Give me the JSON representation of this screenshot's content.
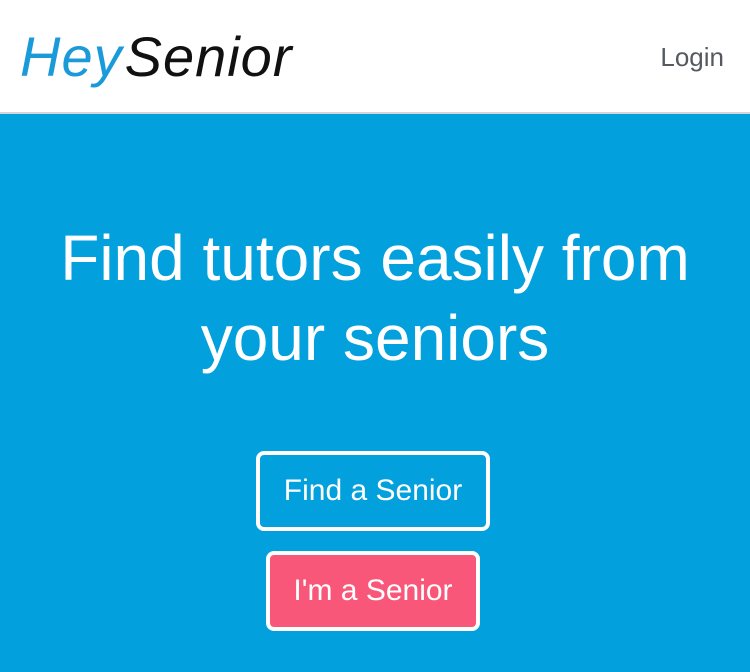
{
  "navbar": {
    "logo": {
      "part1": "Hey",
      "part2": "Senior",
      "part1_color": "#1a9ad9",
      "part2_color": "#111111"
    },
    "login_label": "Login"
  },
  "hero": {
    "background_color": "#02a0dd",
    "title_line1": "Find tutors easily from",
    "title_line2": "your seniors",
    "find_button_label": "Find a Senior",
    "senior_button_label": "I'm a Senior",
    "senior_button_color": "#f9577a"
  }
}
